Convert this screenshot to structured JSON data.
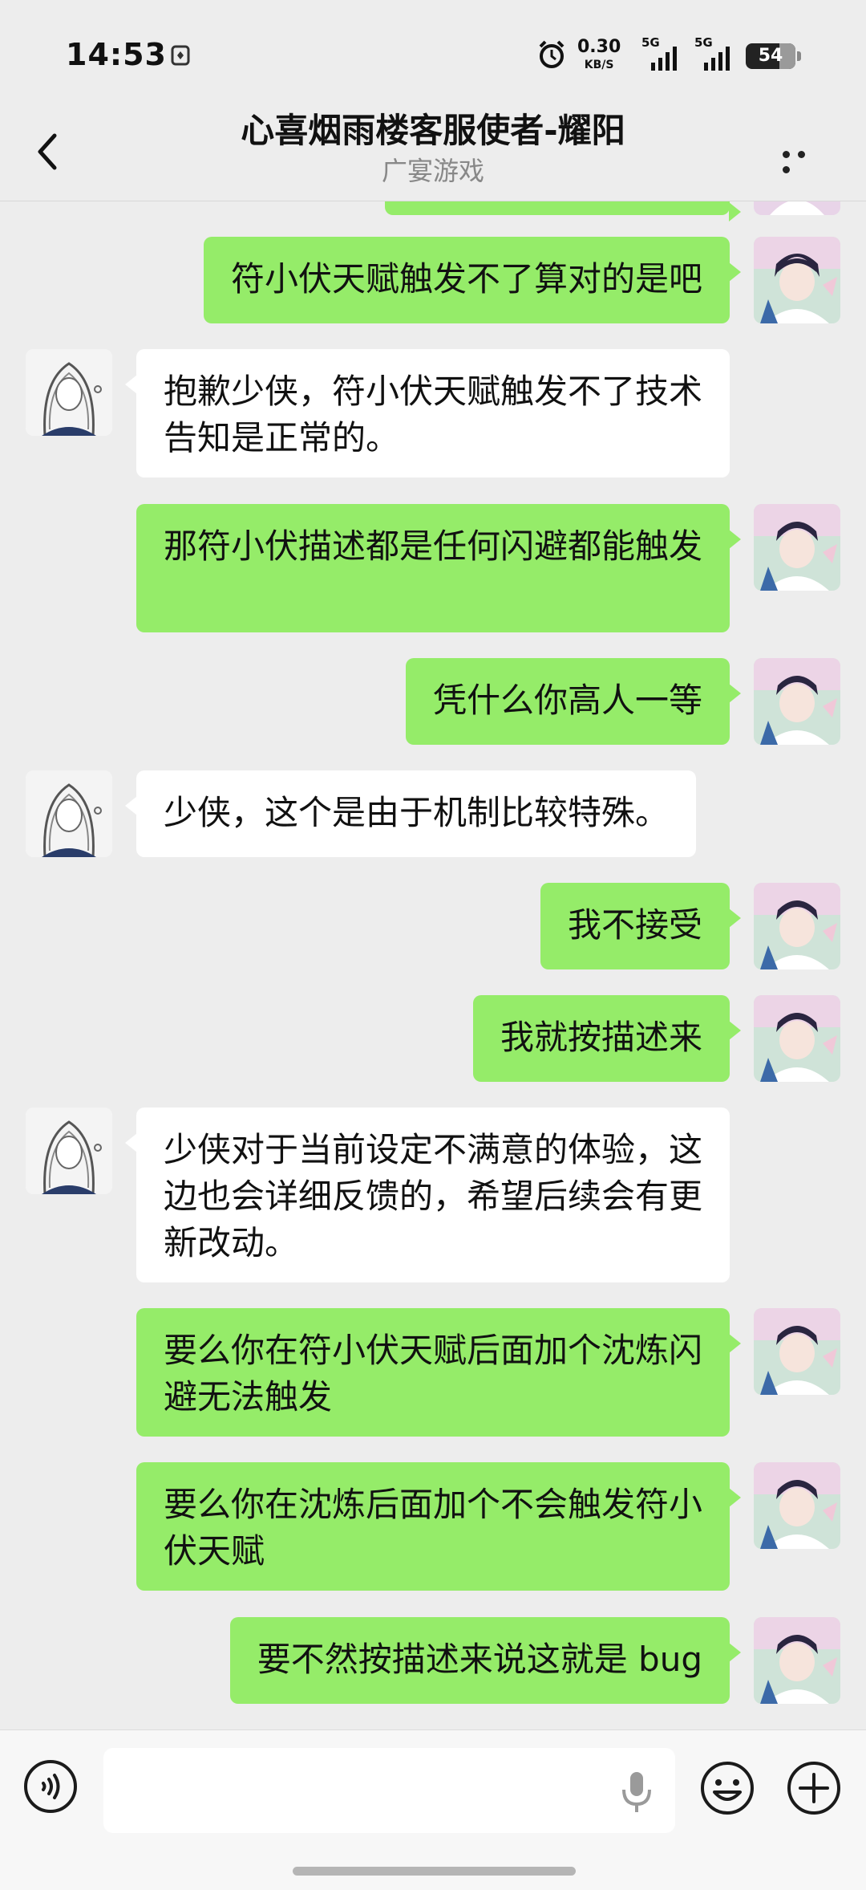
{
  "status_bar": {
    "time": "14:53",
    "net_speed_value": "0.30",
    "net_speed_unit": "KB/S",
    "signal_1": "5G",
    "signal_2": "5G",
    "battery": "54"
  },
  "header": {
    "title": "心喜烟雨楼客服使者-耀阳",
    "subtitle": "广宴游戏"
  },
  "messages": [
    {
      "from": "me",
      "text": "符小伏天赋触发不了算对的是吧"
    },
    {
      "from": "them",
      "text": "抱歉少侠，符小伏天赋触发不了技术告知是正常的。"
    },
    {
      "from": "me",
      "text": "那符小伏描述都是任何闪避都能触发"
    },
    {
      "from": "me",
      "text": "凭什么你高人一等"
    },
    {
      "from": "them",
      "text": "少侠，这个是由于机制比较特殊。"
    },
    {
      "from": "me",
      "text": "我不接受"
    },
    {
      "from": "me",
      "text": "我就按描述来"
    },
    {
      "from": "them",
      "text": "少侠对于当前设定不满意的体验，这边也会详细反馈的，希望后续会有更新改动。"
    },
    {
      "from": "me",
      "text": "要么你在符小伏天赋后面加个沈炼闪避无法触发"
    },
    {
      "from": "me",
      "text": "要么你在沈炼后面加个不会触发符小伏天赋"
    },
    {
      "from": "me",
      "text": "要不然按描述来说这就是 bug"
    }
  ],
  "input": {
    "value": "",
    "placeholder": ""
  },
  "icons": {
    "back": "chevron-left-icon",
    "more": "more-dots-icon",
    "voice": "voice-icon",
    "mic": "mic-icon",
    "emoji": "emoji-icon",
    "plus": "plus-icon"
  },
  "colors": {
    "background": "#ededed",
    "my_bubble": "#95ec69",
    "their_bubble": "#ffffff",
    "subtitle": "#888888"
  }
}
